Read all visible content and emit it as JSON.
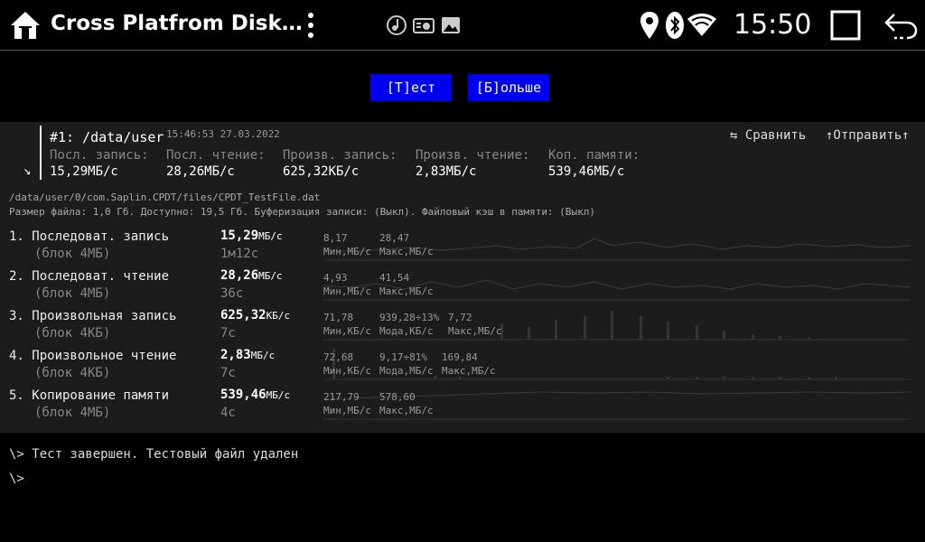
{
  "app": {
    "title": "Cross Platfrom Disk…"
  },
  "statusbar": {
    "time": "15:50"
  },
  "buttons": {
    "test": "[Т]ест",
    "more": "[Б]ольше"
  },
  "run": {
    "title": "#1: /data/user",
    "timestamp": "15:46:53 27.03.2022",
    "compare": "⇆ Сравнить",
    "send": "↑Отправить↑",
    "summary": [
      {
        "label": "Посл. запись:",
        "value": "15,29МБ/с"
      },
      {
        "label": "Посл. чтение:",
        "value": "28,26МБ/с"
      },
      {
        "label": "Произв. запись:",
        "value": "625,32КБ/с"
      },
      {
        "label": "Произв. чтение:",
        "value": "2,83МБ/с"
      },
      {
        "label": "Коп. памяти:",
        "value": "539,46МБ/с"
      }
    ]
  },
  "file": {
    "path": "/data/user/0/com.Saplin.CPDT/files/CPDT_TestFile.dat",
    "info": "Размер файла: 1,0 Гб. Доступно: 19,5 Гб. Буферизация записи: (Выкл). Файловый кэш в памяти: (Выкл)"
  },
  "tests": [
    {
      "name": "1. Последоват. запись",
      "block": "(блок 4МБ)",
      "value": "15,29",
      "unit": "МБ/с",
      "time": "1м12с",
      "stats": [
        {
          "v": "8,17",
          "l": "Мин,МБ/с"
        },
        {
          "v": "28,47",
          "l": "Макс,МБ/с"
        }
      ]
    },
    {
      "name": "2. Последоват. чтение",
      "block": "(блок 4МБ)",
      "value": "28,26",
      "unit": "МБ/с",
      "time": "36с",
      "stats": [
        {
          "v": "4,93",
          "l": "Мин,МБ/с"
        },
        {
          "v": "41,54",
          "l": "Макс,МБ/с"
        }
      ]
    },
    {
      "name": "3. Произвольная запись",
      "block": "(блок 4КБ)",
      "value": "625,32",
      "unit": "КБ/с",
      "time": "7с",
      "stats": [
        {
          "v": "71,78",
          "l": "Мин,КБ/с"
        },
        {
          "v": "939,28÷13%",
          "l": "Мода,КБ/с"
        },
        {
          "v": "7,72",
          "l": "Макс,МБ/с"
        }
      ]
    },
    {
      "name": "4. Произвольное чтение",
      "block": "(блок 4КБ)",
      "value": "2,83",
      "unit": "МБ/с",
      "time": "7с",
      "stats": [
        {
          "v": "72,68",
          "l": "Мин,КБ/с"
        },
        {
          "v": "9,17÷81%",
          "l": "Мода,МБ/с"
        },
        {
          "v": "169,84",
          "l": "Макс,МБ/с"
        }
      ]
    },
    {
      "name": "5. Копирование памяти",
      "block": "(блок 4МБ)",
      "value": "539,46",
      "unit": "МБ/с",
      "time": "4с",
      "stats": [
        {
          "v": "217,79",
          "l": "Мин,МБ/с"
        },
        {
          "v": "578,60",
          "l": "Макс,МБ/с"
        }
      ]
    }
  ],
  "console": [
    "\\> Тест завершен. Тестовый файл удален",
    "\\>"
  ],
  "icons": {
    "app": "house-icon",
    "menu": "more-vert-icon",
    "notifications": [
      "music-note-icon",
      "radio-icon",
      "image-icon"
    ],
    "status": [
      "location-icon",
      "bluetooth-icon",
      "wifi-icon"
    ],
    "nav": [
      "recents-square-icon",
      "back-arrow-icon"
    ]
  },
  "colors": {
    "button": "#0000f0",
    "panel": "#1c1c1c",
    "background": "#000000"
  }
}
